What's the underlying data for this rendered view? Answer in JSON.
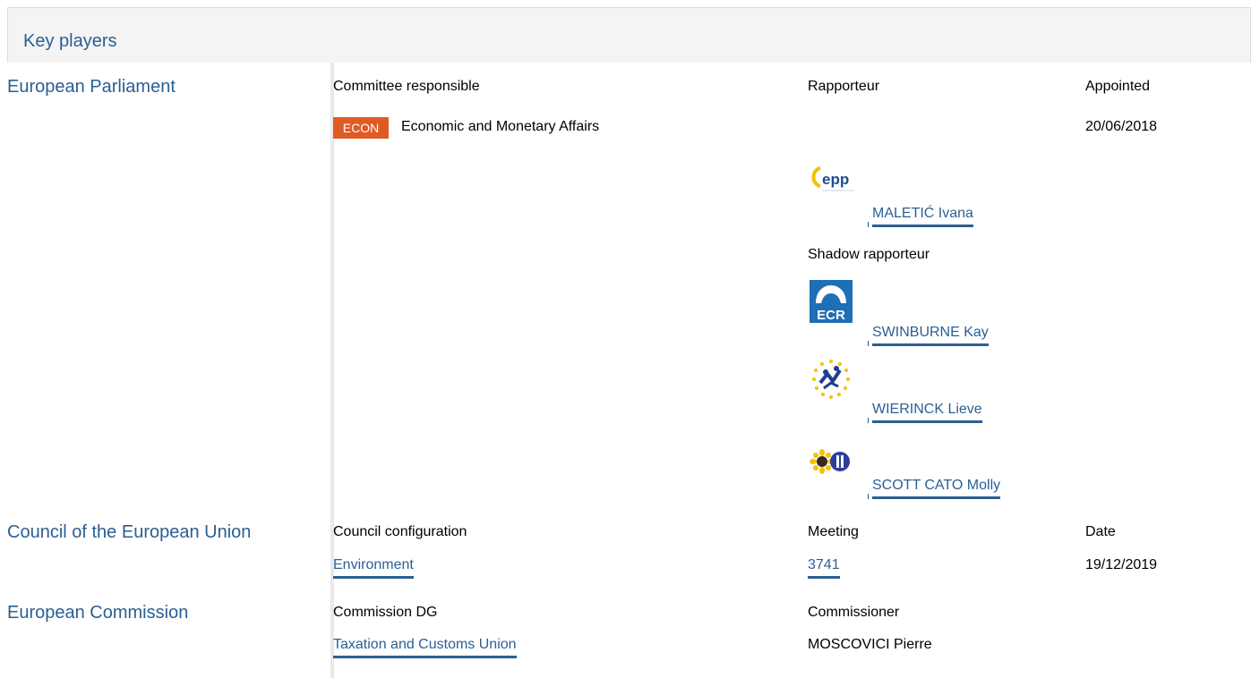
{
  "header": {
    "title": "Key players"
  },
  "parliament": {
    "label": "European Parliament",
    "col_committee": "Committee responsible",
    "col_rapporteur": "Rapporteur",
    "col_appointed": "Appointed",
    "committee_code": "ECON",
    "committee_name": "Economic and Monetary Affairs",
    "appointed_date": "20/06/2018",
    "rapporteur": {
      "name": "MALETIĆ Ivana",
      "group_logo": "epp-logo-icon"
    },
    "shadow_label": "Shadow rapporteur",
    "shadows": [
      {
        "name": "SWINBURNE Kay",
        "group_logo": "ecr-logo-icon"
      },
      {
        "name": "WIERINCK Lieve",
        "group_logo": "alde-logo-icon"
      },
      {
        "name": "SCOTT CATO Molly",
        "group_logo": "greens-efa-logo-icon"
      }
    ]
  },
  "council": {
    "label": "Council of the European Union",
    "col_config": "Council configuration",
    "col_meeting": "Meeting",
    "col_date": "Date",
    "config": "Environment",
    "meeting": "3741",
    "date": "19/12/2019"
  },
  "commission": {
    "label": "European Commission",
    "col_dg": "Commission DG",
    "col_commissioner": "Commissioner",
    "dg": "Taxation and Customs Union",
    "commissioner": "MOSCOVICI Pierre"
  },
  "colors": {
    "link": "#2a5f93",
    "badge": "#e05a25",
    "header_bg": "#f4f4f4"
  }
}
